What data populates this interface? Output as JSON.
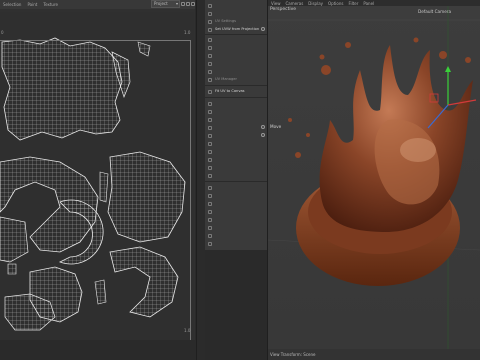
{
  "uv_editor": {
    "menu": [
      "Selection",
      "Paint",
      "Texture"
    ],
    "project_dropdown": "Project",
    "tick_top_left": "0",
    "tick_top_right": "1.0",
    "tick_bottom_right": "1.0"
  },
  "attribute_list": {
    "items": [
      {
        "label": "UV Settings",
        "highlight": false
      },
      {
        "label": "Set UVW from Projection",
        "highlight": true
      },
      {
        "label": "UV Manager",
        "highlight": false
      },
      {
        "label": "Fit UV to Canvas",
        "highlight": true
      }
    ]
  },
  "viewport": {
    "menu": [
      "View",
      "Cameras",
      "Display",
      "Options",
      "Filter",
      "Panel"
    ],
    "projection_label": "Perspective",
    "camera_label": "Default Camera",
    "tool_label": "Move",
    "footer_label": "View Transform: Scene"
  },
  "colors": {
    "chocolate": "#7a3a22",
    "axis_x": "#d23a3a",
    "axis_y": "#3ad23a",
    "axis_z": "#3a6ad2"
  }
}
